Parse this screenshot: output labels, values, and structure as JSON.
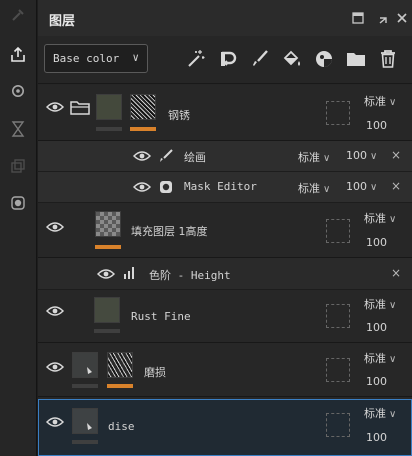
{
  "sidebar": {
    "icons": [
      "eyedropper-icon",
      "export-icon",
      "settings-gear-icon",
      "hourglass-icon",
      "layers-copy-icon",
      "sphere-icon"
    ]
  },
  "panel": {
    "title": "图层",
    "channel_select": {
      "value": "Base color"
    }
  },
  "layers": [
    {
      "name": "钢锈",
      "blend": "标准",
      "opacity": "100"
    },
    {
      "name": "填充图层 1高度",
      "blend": "标准",
      "opacity": "100"
    },
    {
      "name": "Rust Fine",
      "blend": "标准",
      "opacity": "100"
    },
    {
      "name": "磨损",
      "blend": "标准",
      "opacity": "100"
    },
    {
      "name": "dise",
      "blend": "标准",
      "opacity": "100"
    }
  ],
  "effects": [
    {
      "name": "绘画",
      "blend": "标准",
      "opacity": "100"
    },
    {
      "name": "Mask Editor",
      "blend": "标准",
      "opacity": "100"
    },
    {
      "name": "色阶 - Height"
    }
  ],
  "colors": {
    "accent_orange": "#d9822b",
    "selection_blue": "#3a7fc4"
  }
}
